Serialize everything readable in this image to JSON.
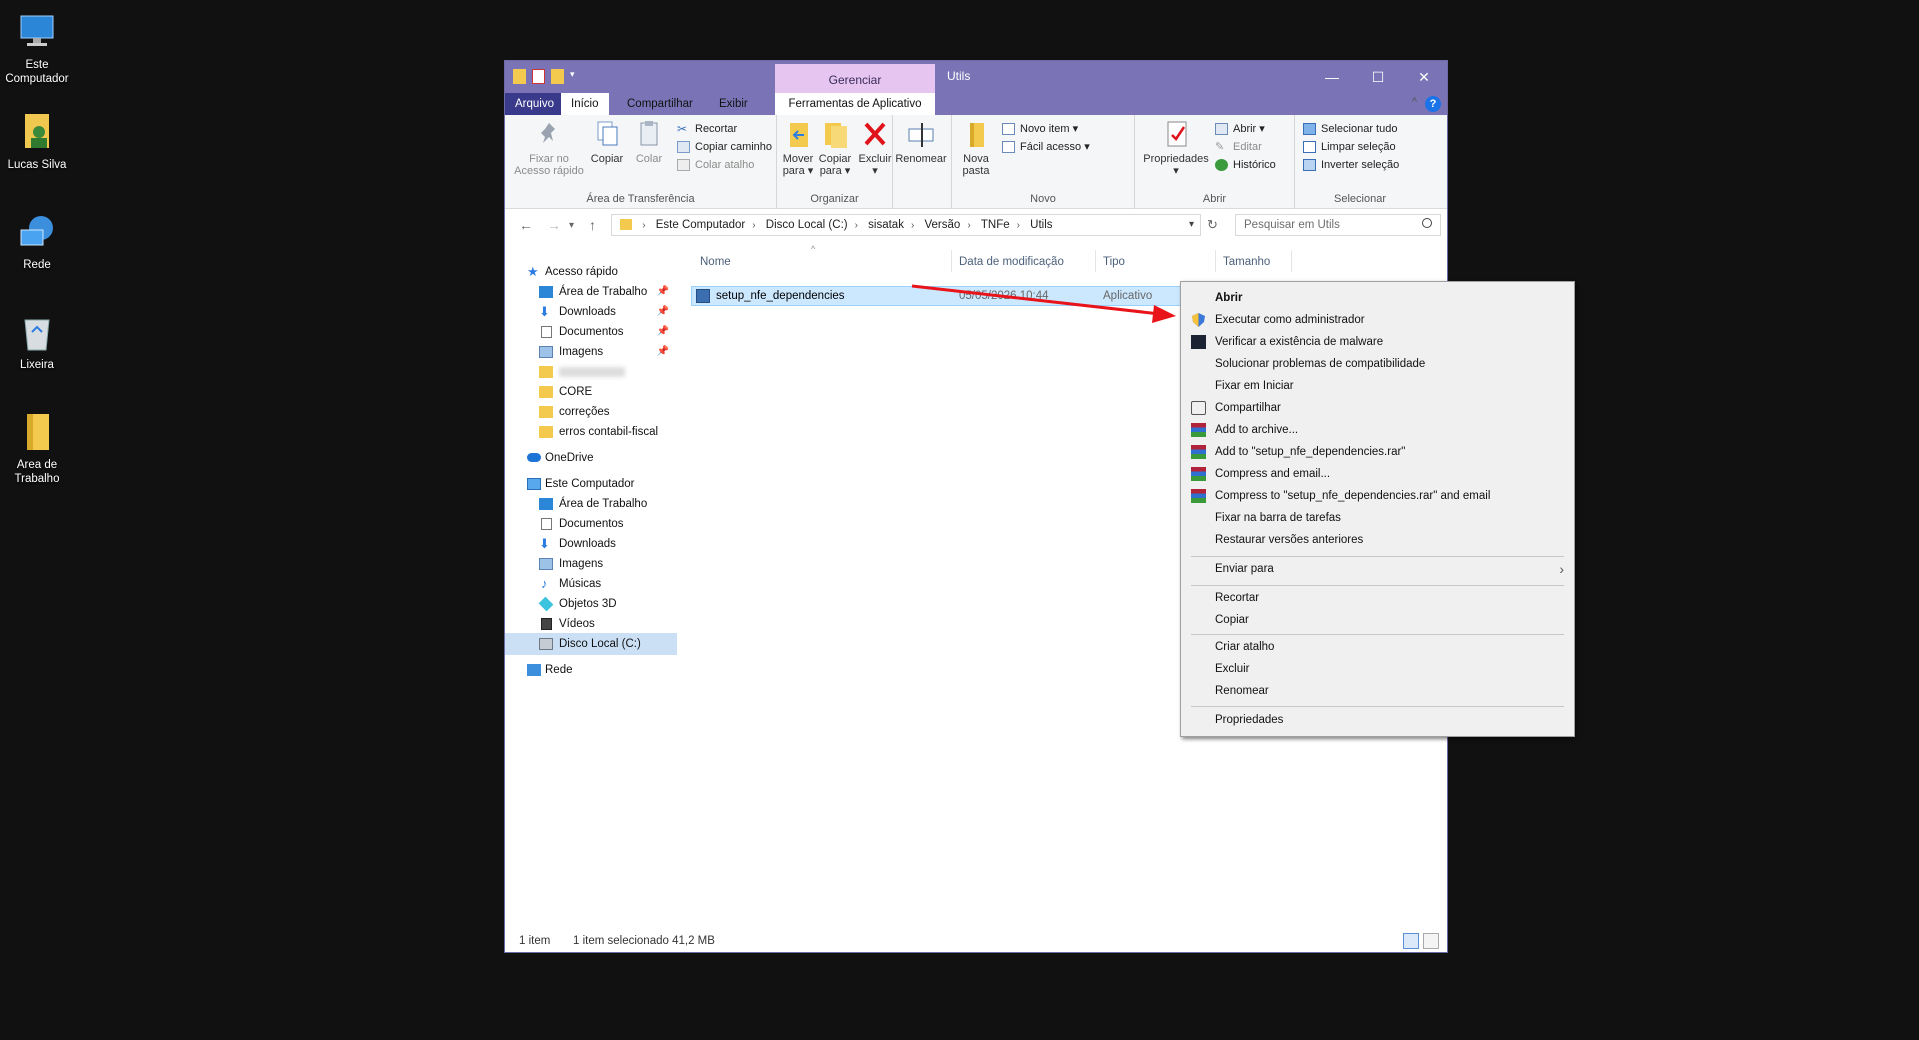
{
  "desktop": {
    "icons": [
      {
        "label": "Este Computador",
        "icon": "computer-icon"
      },
      {
        "label": "Lucas Silva",
        "icon": "user-folder-icon"
      },
      {
        "label": "Rede",
        "icon": "network-icon"
      },
      {
        "label": "Lixeira",
        "icon": "recycle-bin-icon"
      },
      {
        "label": "Area de Trabalho",
        "icon": "folder-icon"
      }
    ]
  },
  "window": {
    "title": "Utils",
    "context_tab": "Gerenciar",
    "tabs": [
      "Arquivo",
      "Início",
      "Compartilhar",
      "Exibir",
      "Ferramentas de Aplicativo"
    ],
    "help": "?"
  },
  "ribbon": {
    "clipboard": {
      "label": "Área de Transferência",
      "pin_line1": "Fixar no",
      "pin_line2": "Acesso rápido",
      "copy": "Copiar",
      "paste": "Colar",
      "cut": "Recortar",
      "copy_path": "Copiar caminho",
      "paste_shortcut": "Colar atalho"
    },
    "organize": {
      "label": "Organizar",
      "move_line1": "Mover",
      "move_line2": "para",
      "copy_line1": "Copiar",
      "copy_line2": "para",
      "delete": "Excluir",
      "rename": "Renomear"
    },
    "new": {
      "label": "Novo",
      "folder_line1": "Nova",
      "folder_line2": "pasta",
      "new_item": "Novo item",
      "easy_access": "Fácil acesso"
    },
    "open": {
      "label": "Abrir",
      "properties": "Propriedades",
      "open": "Abrir",
      "edit": "Editar",
      "history": "Histórico"
    },
    "select": {
      "label": "Selecionar",
      "all": "Selecionar tudo",
      "none": "Limpar seleção",
      "invert": "Inverter seleção"
    }
  },
  "address": {
    "crumbs": [
      "Este Computador",
      "Disco Local (C:)",
      "sisatak",
      "Versão",
      "TNFe",
      "Utils"
    ],
    "search_placeholder": "Pesquisar em Utils"
  },
  "nav": {
    "quick_access": "Acesso rápido",
    "quick_items": [
      "Área de Trabalho",
      "Downloads",
      "Documentos",
      "Imagens"
    ],
    "folders": [
      "CORE",
      "correções",
      "erros contabil-fiscal"
    ],
    "onedrive": "OneDrive",
    "this_pc": "Este Computador",
    "pc_items": [
      "Área de Trabalho",
      "Documentos",
      "Downloads",
      "Imagens",
      "Músicas",
      "Objetos 3D",
      "Vídeos",
      "Disco Local (C:)"
    ],
    "network": "Rede"
  },
  "files": {
    "columns": [
      "Nome",
      "Data de modificação",
      "Tipo",
      "Tamanho"
    ],
    "rows": [
      {
        "name": "setup_nfe_dependencies",
        "date": "05/05/2026 10:44",
        "type": "Aplicativo"
      }
    ]
  },
  "status": {
    "count": "1 item",
    "selection": "1 item selecionado  41,2 MB"
  },
  "context_menu": {
    "items": [
      "Abrir",
      "Executar como administrador",
      "Verificar a existência de malware",
      "Solucionar problemas de compatibilidade",
      "Fixar em Iniciar",
      "Compartilhar",
      "Add to archive...",
      "Add to \"setup_nfe_dependencies.rar\"",
      "Compress and email...",
      "Compress to \"setup_nfe_dependencies.rar\" and email",
      "Fixar na barra de tarefas",
      "Restaurar versões anteriores",
      "Enviar para",
      "Recortar",
      "Copiar",
      "Criar atalho",
      "Excluir",
      "Renomear",
      "Propriedades"
    ]
  },
  "colors": {
    "titlebar": "#7a74b6",
    "manage_tab": "#e6c6f0",
    "selection": "#cce8ff",
    "arrow": "#e8141a"
  }
}
